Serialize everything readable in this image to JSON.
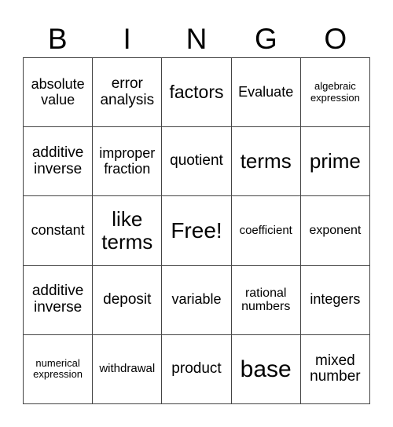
{
  "header": [
    "B",
    "I",
    "N",
    "G",
    "O"
  ],
  "cells": [
    [
      "absolute value",
      "error analysis",
      "factors",
      "Evaluate",
      "algebraic expression"
    ],
    [
      "additive inverse",
      "improper fraction",
      "quotient",
      "terms",
      "prime"
    ],
    [
      "constant",
      "like terms",
      "Free!",
      "coefficient",
      "exponent"
    ],
    [
      "additive inverse",
      "deposit",
      "variable",
      "rational numbers",
      "integers"
    ],
    [
      "numerical expression",
      "withdrawal",
      "product",
      "base",
      "mixed number"
    ]
  ]
}
